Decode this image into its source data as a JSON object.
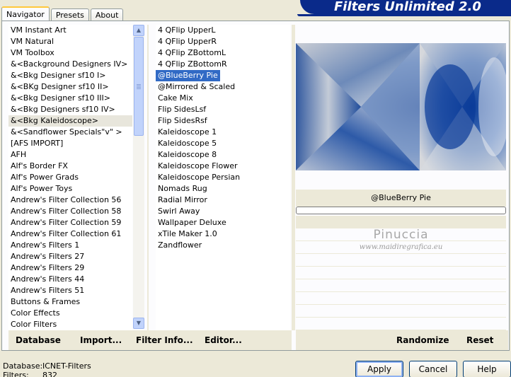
{
  "tabs": [
    "Navigator",
    "Presets",
    "About"
  ],
  "banner_title": "Filters Unlimited 2.0",
  "categories": [
    "VM Instant Art",
    "VM Natural",
    "VM Toolbox",
    "&<Background Designers IV>",
    "&<Bkg Designer sf10 I>",
    "&<BKg Designer sf10 II>",
    "&<Bkg Designer sf10 III>",
    "&<Bkg Designers sf10 IV>",
    "&<Bkg Kaleidoscope>",
    "&<Sandflower Specials\"v\" >",
    "[AFS IMPORT]",
    "AFH",
    "Alf's Border FX",
    "Alf's Power Grads",
    "Alf's Power Toys",
    "Andrew's Filter Collection 56",
    "Andrew's Filter Collection 58",
    "Andrew's Filter Collection 59",
    "Andrew's Filter Collection 61",
    "Andrew's Filters 1",
    "Andrew's Filters 27",
    "Andrew's Filters 29",
    "Andrew's Filters 44",
    "Andrew's Filters 51",
    "Buttons & Frames",
    "Color Effects",
    "Color Filters"
  ],
  "selected_category": "&<Bkg Kaleidoscope>",
  "filters": [
    "4 QFlip UpperL",
    "4 QFlip UpperR",
    "4 QFlip ZBottomL",
    "4 QFlip ZBottomR",
    "@BlueBerry Pie",
    "@Mirrored & Scaled",
    "Cake Mix",
    "Flip SidesLsf",
    "Flip SidesRsf",
    "Kaleidoscope 1",
    "Kaleidoscope 5",
    "Kaleidoscope 8",
    "Kaleidoscope Flower",
    "Kaleidoscope Persian",
    "Nomads Rug",
    "Radial Mirror",
    "Swirl Away",
    "Wallpaper Deluxe",
    "xTile Maker 1.0",
    "Zandflower"
  ],
  "selected_filter": "@BlueBerry Pie",
  "preview_filter_name": "@BlueBerry Pie",
  "watermark": {
    "name": "Pinuccia",
    "url": "www.maidiregrafica.eu"
  },
  "links": {
    "database": "Database",
    "import": "Import...",
    "filter_info": "Filter Info...",
    "editor": "Editor...",
    "randomize": "Randomize",
    "reset": "Reset"
  },
  "footer": {
    "database_label": "Database:",
    "database_value": "ICNET-Filters",
    "filters_label": "Filters:",
    "filters_value": "832"
  },
  "buttons": {
    "apply": "Apply",
    "cancel": "Cancel",
    "help": "Help"
  },
  "icons": {
    "scroll_up": "scroll-up-arrow-icon",
    "scroll_down": "scroll-down-arrow-icon"
  },
  "colors": {
    "banner": "#0a2a8a",
    "selection": "#316ac5",
    "active_tab_accent": "#ffc83c"
  }
}
